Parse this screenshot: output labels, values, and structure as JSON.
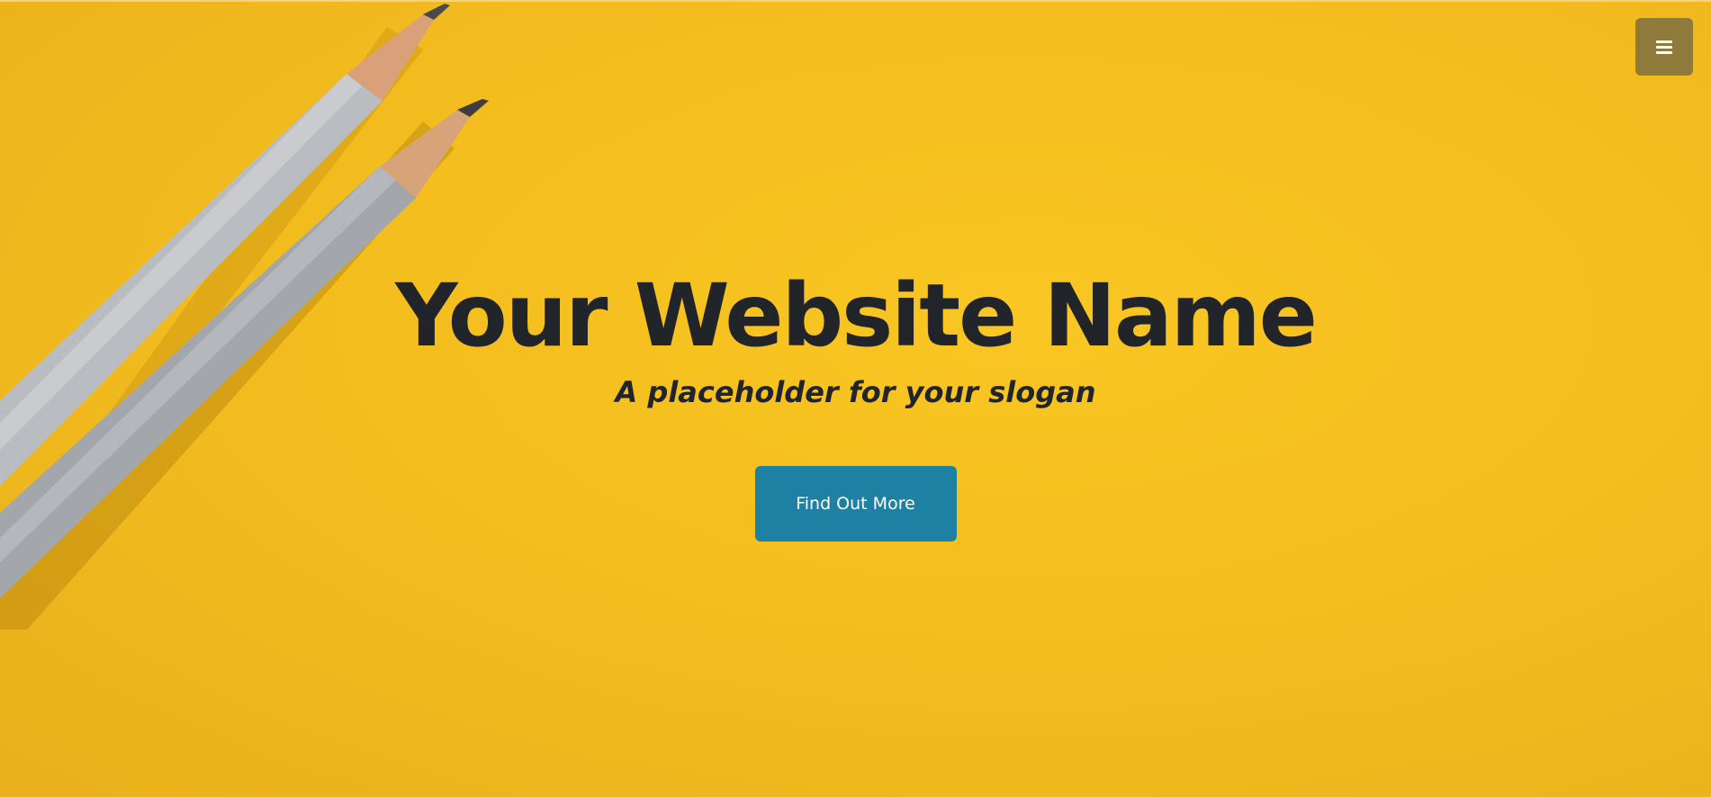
{
  "header": {
    "menu_icon": "hamburger-menu-icon"
  },
  "hero": {
    "title": "Your Website Name",
    "slogan": "A placeholder for your slogan",
    "cta_label": "Find Out More"
  },
  "colors": {
    "background": "#f4be1e",
    "text": "#212529",
    "cta_background": "#1e80a2",
    "cta_text": "#ffffff",
    "menu_background": "#8e7a3a"
  }
}
